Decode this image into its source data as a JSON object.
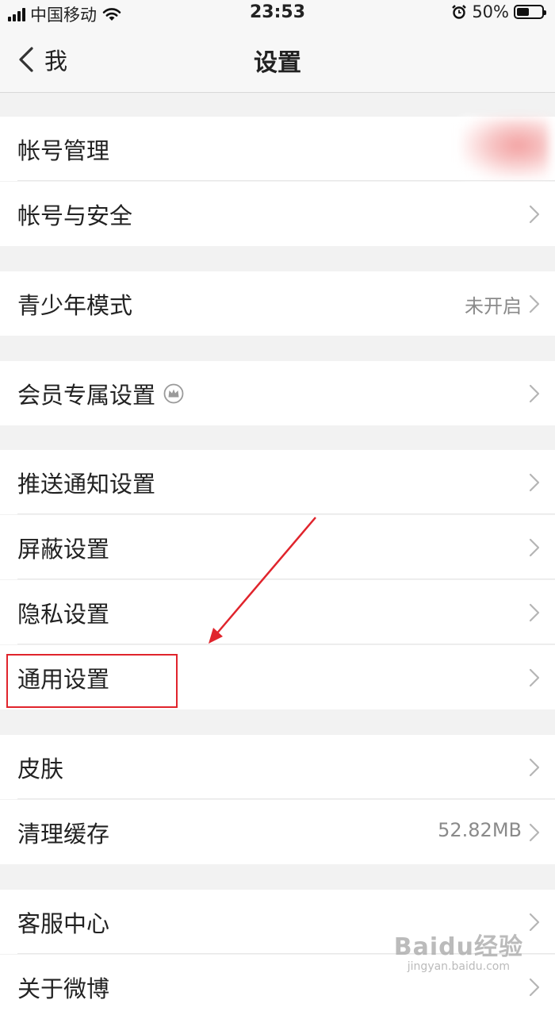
{
  "status_bar": {
    "carrier": "中国移动",
    "time": "23:53",
    "battery": "50%",
    "battery_level": 0.5
  },
  "nav": {
    "back_label": "我",
    "title": "设置"
  },
  "sections": [
    {
      "rows": [
        {
          "label": "帐号管理",
          "has_chevron": false
        },
        {
          "label": "帐号与安全",
          "has_chevron": true
        }
      ]
    },
    {
      "rows": [
        {
          "label": "青少年模式",
          "value": "未开启",
          "has_chevron": true
        }
      ]
    },
    {
      "rows": [
        {
          "label": "会员专属设置",
          "icon": "crown-icon",
          "has_chevron": true
        }
      ]
    },
    {
      "rows": [
        {
          "label": "推送通知设置",
          "has_chevron": true
        },
        {
          "label": "屏蔽设置",
          "has_chevron": true
        },
        {
          "label": "隐私设置",
          "has_chevron": true
        },
        {
          "label": "通用设置",
          "has_chevron": true,
          "highlighted": true
        }
      ]
    },
    {
      "rows": [
        {
          "label": "皮肤",
          "has_chevron": true
        },
        {
          "label": "清理缓存",
          "value": "52.82MB",
          "has_chevron": true
        }
      ]
    },
    {
      "rows": [
        {
          "label": "客服中心",
          "has_chevron": true
        },
        {
          "label": "关于微博",
          "has_chevron": true
        }
      ]
    }
  ],
  "watermark": {
    "title": "Baidu经验",
    "subtitle": "jingyan.baidu.com"
  },
  "colors": {
    "annotation": "#e0242c",
    "background": "#f2f2f2",
    "secondary_text": "#8a8a8a"
  }
}
